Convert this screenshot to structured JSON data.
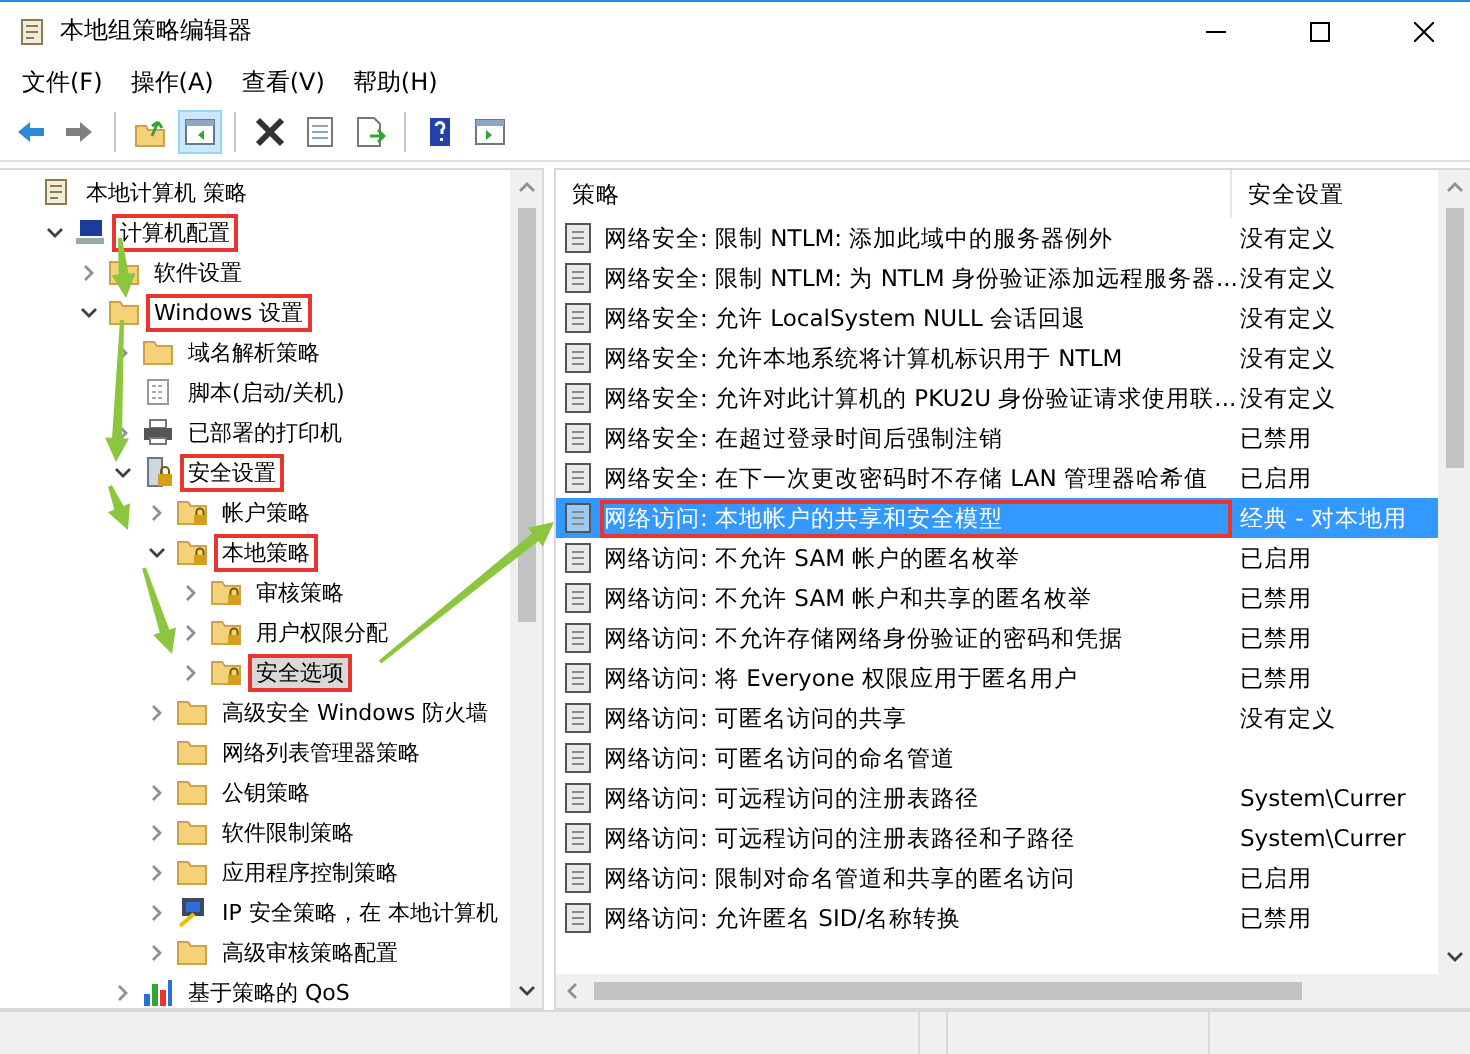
{
  "window": {
    "title": "本地组策略编辑器"
  },
  "menu": [
    "文件(F)",
    "操作(A)",
    "查看(V)",
    "帮助(H)"
  ],
  "toolbar": [
    [
      {
        "kind": "back",
        "pressed": false
      },
      {
        "kind": "forward",
        "pressed": false
      }
    ],
    [
      {
        "kind": "up",
        "pressed": false
      },
      {
        "kind": "tree",
        "pressed": true
      }
    ],
    [
      {
        "kind": "delete",
        "pressed": false
      },
      {
        "kind": "properties",
        "pressed": false
      },
      {
        "kind": "export",
        "pressed": false
      }
    ],
    [
      {
        "kind": "help",
        "pressed": false
      },
      {
        "kind": "actionpane",
        "pressed": false
      }
    ]
  ],
  "tree": [
    {
      "label": "本地计算机 策略",
      "kind": "policy",
      "selected": false,
      "highlighted": false,
      "children": [
        {
          "label": "计算机配置",
          "kind": "computer",
          "expanded": true,
          "selected": false,
          "highlighted": true,
          "children": [
            {
              "label": "软件设置",
              "kind": "folder",
              "expanded": false,
              "selected": false,
              "highlighted": false
            },
            {
              "label": "Windows 设置",
              "kind": "folder",
              "expanded": true,
              "selected": false,
              "highlighted": true,
              "children": [
                {
                  "label": "域名解析策略",
                  "kind": "folder",
                  "expanded": false,
                  "selected": false,
                  "highlighted": false
                },
                {
                  "label": "脚本(启动/关机)",
                  "kind": "script",
                  "selected": false,
                  "highlighted": false
                },
                {
                  "label": "已部署的打印机",
                  "kind": "printer",
                  "expanded": false,
                  "selected": false,
                  "highlighted": false
                },
                {
                  "label": "安全设置",
                  "kind": "security",
                  "expanded": true,
                  "selected": false,
                  "highlighted": true,
                  "children": [
                    {
                      "label": "帐户策略",
                      "kind": "lockfolder",
                      "expanded": false,
                      "selected": false,
                      "highlighted": false
                    },
                    {
                      "label": "本地策略",
                      "kind": "lockfolder",
                      "expanded": true,
                      "selected": false,
                      "highlighted": true,
                      "children": [
                        {
                          "label": "审核策略",
                          "kind": "lockfolder",
                          "expanded": false,
                          "selected": false,
                          "highlighted": false
                        },
                        {
                          "label": "用户权限分配",
                          "kind": "lockfolder",
                          "expanded": false,
                          "selected": false,
                          "highlighted": false
                        },
                        {
                          "label": "安全选项",
                          "kind": "lockfolder",
                          "expanded": false,
                          "selected": true,
                          "highlighted": true
                        }
                      ]
                    },
                    {
                      "label": "高级安全 Windows 防火墙",
                      "kind": "folder",
                      "expanded": false,
                      "selected": false,
                      "highlighted": false
                    },
                    {
                      "label": "网络列表管理器策略",
                      "kind": "folder",
                      "selected": false,
                      "highlighted": false
                    },
                    {
                      "label": "公钥策略",
                      "kind": "folder",
                      "expanded": false,
                      "selected": false,
                      "highlighted": false
                    },
                    {
                      "label": "软件限制策略",
                      "kind": "folder",
                      "expanded": false,
                      "selected": false,
                      "highlighted": false
                    },
                    {
                      "label": "应用程序控制策略",
                      "kind": "folder",
                      "expanded": false,
                      "selected": false,
                      "highlighted": false
                    },
                    {
                      "label": "IP 安全策略，在 本地计算机",
                      "kind": "ipsec",
                      "expanded": false,
                      "selected": false,
                      "highlighted": false
                    },
                    {
                      "label": "高级审核策略配置",
                      "kind": "folder",
                      "expanded": false,
                      "selected": false,
                      "highlighted": false
                    }
                  ]
                },
                {
                  "label": "基于策略的 QoS",
                  "kind": "qos",
                  "expanded": false,
                  "selected": false,
                  "highlighted": false
                }
              ]
            }
          ]
        }
      ]
    }
  ],
  "list": {
    "columns": [
      "策略",
      "安全设置"
    ],
    "rows": [
      {
        "name": "网络安全: 限制 NTLM: 添加此域中的服务器例外",
        "setting": "没有定义",
        "selected": false,
        "highlighted": false
      },
      {
        "name": "网络安全: 限制 NTLM: 为 NTLM 身份验证添加远程服务器...",
        "setting": "没有定义",
        "selected": false,
        "highlighted": false
      },
      {
        "name": "网络安全: 允许 LocalSystem NULL 会话回退",
        "setting": "没有定义",
        "selected": false,
        "highlighted": false
      },
      {
        "name": "网络安全: 允许本地系统将计算机标识用于 NTLM",
        "setting": "没有定义",
        "selected": false,
        "highlighted": false
      },
      {
        "name": "网络安全: 允许对此计算机的 PKU2U 身份验证请求使用联...",
        "setting": "没有定义",
        "selected": false,
        "highlighted": false
      },
      {
        "name": "网络安全: 在超过登录时间后强制注销",
        "setting": "已禁用",
        "selected": false,
        "highlighted": false
      },
      {
        "name": "网络安全: 在下一次更改密码时不存储 LAN 管理器哈希值",
        "setting": "已启用",
        "selected": false,
        "highlighted": false
      },
      {
        "name": "网络访问: 本地帐户的共享和安全模型",
        "setting": "经典 - 对本地用",
        "selected": true,
        "highlighted": true
      },
      {
        "name": "网络访问: 不允许 SAM 帐户的匿名枚举",
        "setting": "已启用",
        "selected": false,
        "highlighted": false
      },
      {
        "name": "网络访问: 不允许 SAM 帐户和共享的匿名枚举",
        "setting": "已禁用",
        "selected": false,
        "highlighted": false
      },
      {
        "name": "网络访问: 不允许存储网络身份验证的密码和凭据",
        "setting": "已禁用",
        "selected": false,
        "highlighted": false
      },
      {
        "name": "网络访问: 将 Everyone 权限应用于匿名用户",
        "setting": "已禁用",
        "selected": false,
        "highlighted": false
      },
      {
        "name": "网络访问: 可匿名访问的共享",
        "setting": "没有定义",
        "selected": false,
        "highlighted": false
      },
      {
        "name": "网络访问: 可匿名访问的命名管道",
        "selected": false,
        "highlighted": false
      },
      {
        "name": "网络访问: 可远程访问的注册表路径",
        "setting": "System\\Currer",
        "selected": false,
        "highlighted": false
      },
      {
        "name": "网络访问: 可远程访问的注册表路径和子路径",
        "setting": "System\\Currer",
        "selected": false,
        "highlighted": false
      },
      {
        "name": "网络访问: 限制对命名管道和共享的匿名访问",
        "setting": "已启用",
        "selected": false,
        "highlighted": false
      },
      {
        "name": "网络访问: 允许匿名 SID/名称转换",
        "setting": "已禁用",
        "selected": false,
        "highlighted": false
      }
    ]
  }
}
